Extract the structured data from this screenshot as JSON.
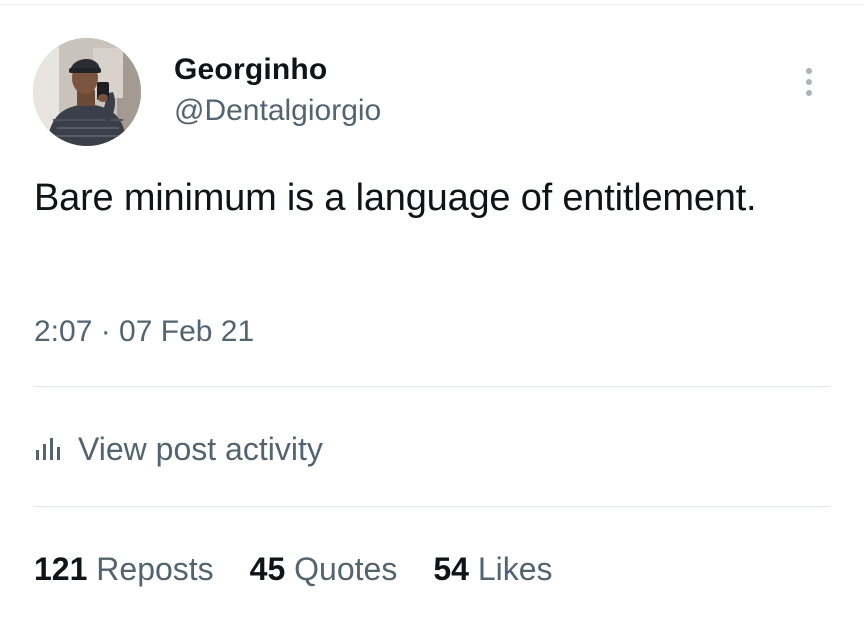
{
  "tweet": {
    "author": {
      "name": "Georginho",
      "handle": "@Dentalgiorgio",
      "avatar": "profile-photo"
    },
    "text": "Bare minimum is a language of entitlement.",
    "timestamp": "2:07 · 07 Feb 21",
    "activity": {
      "icon": "bar-chart-icon",
      "label": "View post activity"
    },
    "stats": [
      {
        "count": "121",
        "label": "Reposts"
      },
      {
        "count": "45",
        "label": "Quotes"
      },
      {
        "count": "54",
        "label": "Likes"
      }
    ],
    "more_icon": "more-vertical-icon"
  },
  "colors": {
    "text_primary": "#0f1419",
    "text_secondary": "#536471",
    "divider": "#e1e6ea"
  }
}
